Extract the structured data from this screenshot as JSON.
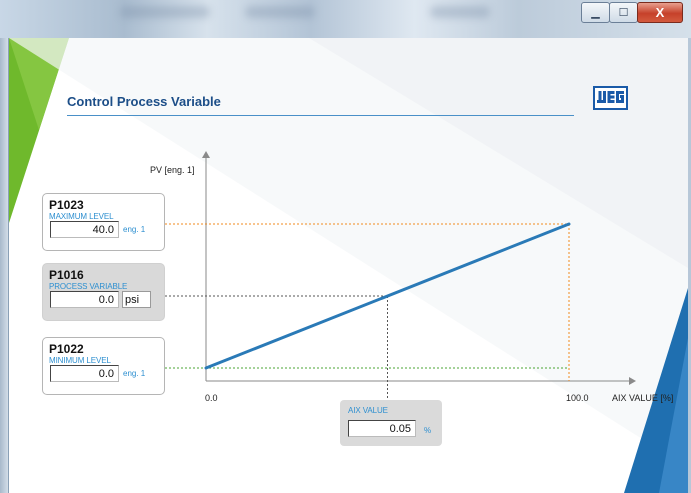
{
  "page": {
    "title": "Control Process Variable",
    "logo_text": "WEG"
  },
  "window": {
    "minimize_symbol": "▁",
    "maximize_symbol": "☐",
    "close_symbol": "X"
  },
  "params": {
    "max": {
      "code": "P1023",
      "desc": "MAXIMUM LEVEL",
      "value": "40.0",
      "unit": "eng. 1"
    },
    "pv": {
      "code": "P1016",
      "desc": "PROCESS VARIABLE",
      "value": "0.0",
      "unit": "psi"
    },
    "min": {
      "code": "P1022",
      "desc": "MINIMUM LEVEL",
      "value": "0.0",
      "unit": "eng. 1"
    },
    "aix": {
      "desc": "AIX VALUE",
      "value": "0.05",
      "unit": "%"
    }
  },
  "chart": {
    "ylabel": "PV [eng. 1]",
    "xlabel": "AIX VALUE [%]",
    "x_min_label": "0.0",
    "x_max_label": "100.0"
  },
  "chart_data": {
    "type": "line",
    "xlabel": "AIX VALUE [%]",
    "ylabel": "PV [eng. 1]",
    "xlim": [
      0,
      100
    ],
    "ylim": [
      0,
      40
    ],
    "x": [
      0,
      100
    ],
    "y": [
      0,
      40
    ]
  },
  "colors": {
    "line": "#2a7ab7",
    "max_guide": "#f08a1e",
    "min_guide": "#4aa533",
    "pv_guide": "#555555",
    "accent_green": "#6fb92c",
    "accent_blue": "#1f6fb0",
    "title": "#1c4e88"
  }
}
